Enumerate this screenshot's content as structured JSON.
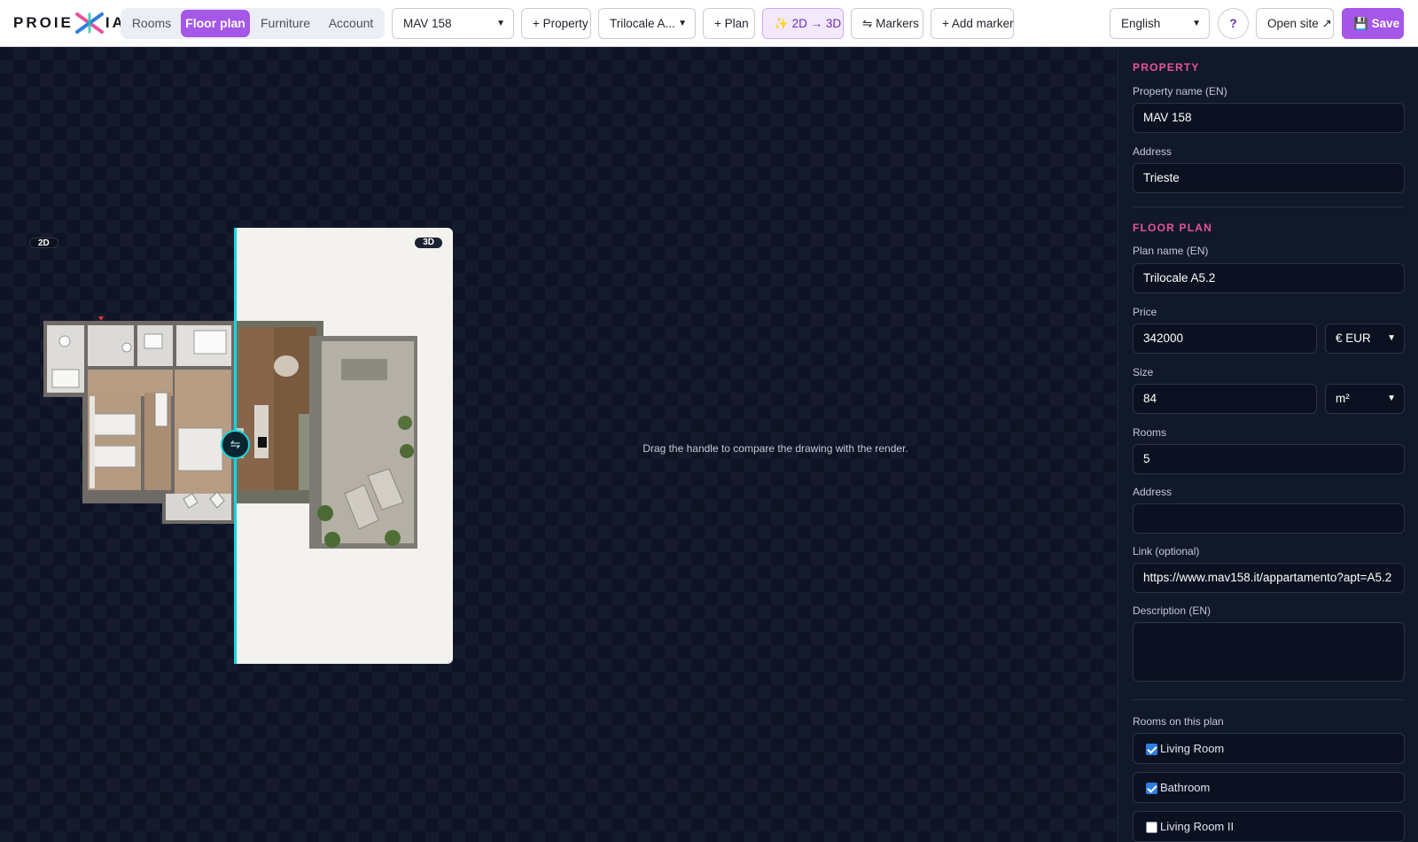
{
  "app": {
    "logo": "PROIEXIA"
  },
  "tabs": [
    {
      "label": "Rooms",
      "active": false
    },
    {
      "label": "Floor plan",
      "active": true
    },
    {
      "label": "Furniture",
      "active": false
    },
    {
      "label": "Account",
      "active": false
    }
  ],
  "toolbar": {
    "property_select": "MAV 158",
    "add_property": "+ Property",
    "plan_select": "Trilocale A...",
    "add_plan": "+ Plan",
    "convert_label": "2D → 3D",
    "markers_label": "Markers",
    "add_marker": "+ Add marker",
    "language_select": "English",
    "help_label": "?",
    "open_site": "Open site ↗",
    "save_label": "Save"
  },
  "canvas": {
    "label_2d": "2D",
    "label_3d": "3D",
    "handle_glyph": "⇋",
    "hint": "Drag the handle to compare the drawing with the render."
  },
  "panel": {
    "property_section": "PROPERTY",
    "property_name_label": "Property name (EN)",
    "property_name_value": "MAV 158",
    "address_label": "Address",
    "address_value": "Trieste",
    "floorplan_section": "FLOOR PLAN",
    "plan_name_label": "Plan name (EN)",
    "plan_name_value": "Trilocale A5.2",
    "price_label": "Price",
    "price_value": "342000",
    "currency_value": "€ EUR",
    "size_label": "Size",
    "size_value": "84",
    "size_unit": "m²",
    "rooms_label": "Rooms",
    "rooms_value": "5",
    "plan_address_label": "Address",
    "plan_address_value": "",
    "link_label": "Link (optional)",
    "link_value": "https://www.mav158.it/appartamento?apt=A5.2",
    "description_label": "Description (EN)",
    "description_value": "",
    "rooms_on_plan_label": "Rooms on this plan",
    "rooms_on_plan": [
      {
        "label": "Living Room",
        "checked": true
      },
      {
        "label": "Bathroom",
        "checked": true
      },
      {
        "label": "Living Room II",
        "checked": false
      }
    ]
  },
  "colors": {
    "accent": "#a557e8",
    "section_heading": "#e8539d",
    "compare_divider": "#18d4dc",
    "panel_bg": "#10182a"
  }
}
